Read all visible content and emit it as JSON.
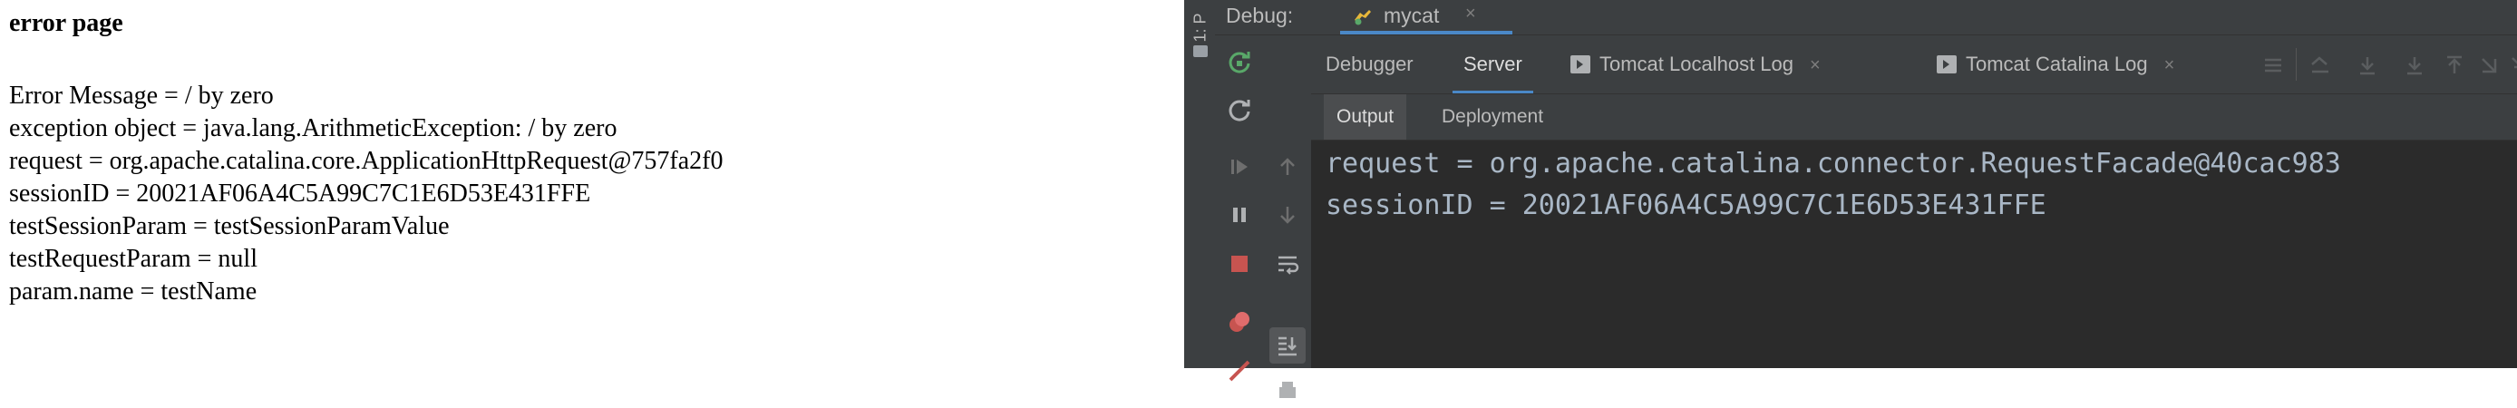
{
  "browser": {
    "title": "error page",
    "lines": [
      "Error Message = / by zero",
      "exception object = java.lang.ArithmeticException: / by zero",
      "request = org.apache.catalina.core.ApplicationHttpRequest@757fa2f0",
      "sessionID = 20021AF06A4C5A99C7C1E6D53E431FFE",
      "testSessionParam = testSessionParamValue",
      "testRequestParam = null",
      "param.name = testName"
    ]
  },
  "ide": {
    "side_strip_label": "1: P",
    "debug_label": "Debug:",
    "run_config": "mycat",
    "close_glyph": "×",
    "tabs": [
      {
        "label": "Debugger"
      },
      {
        "label": "Server"
      },
      {
        "label": "Tomcat Localhost Log"
      },
      {
        "label": "Tomcat Catalina Log"
      }
    ],
    "active_tab": "Server",
    "subtabs": [
      {
        "label": "Output"
      },
      {
        "label": "Deployment"
      }
    ],
    "active_subtab": "Output",
    "console_lines": [
      "request = org.apache.catalina.connector.RequestFacade@40cac983",
      "sessionID = 20021AF06A4C5A99C7C1E6D53E431FFE"
    ],
    "colors": {
      "panel_bg": "#3c3f41",
      "console_bg": "#2b2b2b",
      "console_text": "#a9b7c6",
      "accent_blue": "#4a88c7",
      "rerun_green": "#59a869",
      "stop_red": "#c75450"
    }
  }
}
